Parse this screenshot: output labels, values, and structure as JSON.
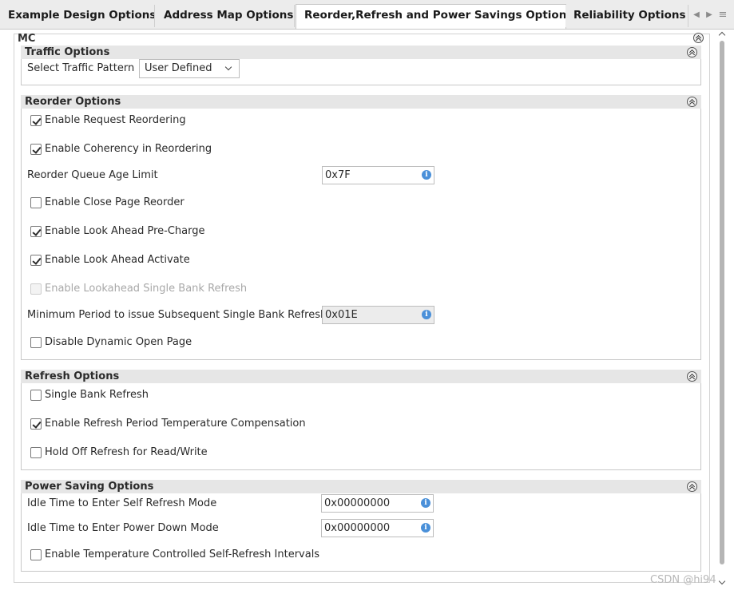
{
  "tabs": [
    {
      "label": "Example Design Options"
    },
    {
      "label": "Address Map Options"
    },
    {
      "label": "Reorder,Refresh and Power Savings Options"
    },
    {
      "label": "Reliability Options"
    }
  ],
  "mc": {
    "title": "MC"
  },
  "traffic": {
    "title": "Traffic Options",
    "pattern_label": "Select Traffic Pattern",
    "pattern_value": "User Defined"
  },
  "reorder": {
    "title": "Reorder Options",
    "request_reordering": "Enable Request Reordering",
    "coherency": "Enable Coherency in Reordering",
    "queue_age_label": "Reorder Queue Age Limit",
    "queue_age_value": "0x7F",
    "close_page": "Enable Close Page Reorder",
    "lookahead_precharge": "Enable Look Ahead Pre-Charge",
    "lookahead_activate": "Enable Look Ahead Activate",
    "lookahead_sbr": "Enable Lookahead Single Bank Refresh",
    "min_period_label": "Minimum Period to issue Subsequent Single Bank Refresh",
    "min_period_value": "0x01E",
    "disable_dynamic": "Disable Dynamic Open Page"
  },
  "refresh": {
    "title": "Refresh Options",
    "single_bank": "Single Bank Refresh",
    "temp_comp": "Enable Refresh Period Temperature Compensation",
    "hold_off": "Hold Off Refresh for Read/Write"
  },
  "power": {
    "title": "Power Saving Options",
    "self_refresh_label": "Idle Time to Enter Self Refresh Mode",
    "self_refresh_value": "0x00000000",
    "power_down_label": "Idle Time to Enter Power Down Mode",
    "power_down_value": "0x00000000",
    "temp_self_refresh": "Enable Temperature Controlled Self-Refresh Intervals"
  },
  "info_glyph": "i",
  "watermark": "CSDN @hi94"
}
